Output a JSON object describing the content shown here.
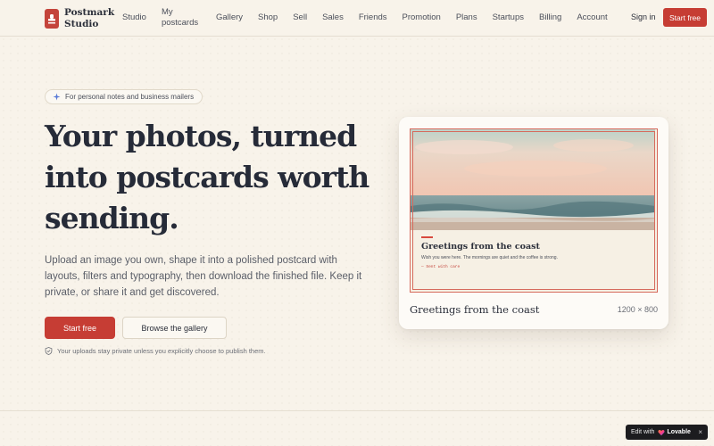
{
  "brand": {
    "name": "Postmark Studio"
  },
  "nav": {
    "links": [
      "Studio",
      "My postcards",
      "Gallery",
      "Shop",
      "Sell",
      "Sales",
      "Friends",
      "Promotion",
      "Plans",
      "Startups",
      "Billing",
      "Account"
    ],
    "signin": "Sign in",
    "start": "Start free"
  },
  "hero": {
    "badge": "For personal notes and business mailers",
    "headline": "Your photos, turned into postcards worth sending.",
    "subtext": "Upload an image you own, shape it into a polished postcard with layouts, filters and typography, then download the finished file. Keep it private, or share it and get discovered.",
    "primary_cta": "Start free",
    "secondary_cta": "Browse the gallery",
    "privacy_note": "Your uploads stay private unless you explicitly choose to publish them."
  },
  "preview": {
    "postcard_title": "Greetings from the coast",
    "postcard_body": "Wish you were here. The mornings are quiet and the coffee is strong.",
    "postcard_sign": "— Sent with care",
    "card_title": "Greetings from the coast",
    "dimensions": "1200 × 800"
  },
  "lovable": {
    "prefix": "Edit with",
    "brand": "Lovable",
    "close": "×"
  },
  "colors": {
    "accent": "#c63d34",
    "background": "#f8f3ea",
    "text": "#262b38"
  }
}
